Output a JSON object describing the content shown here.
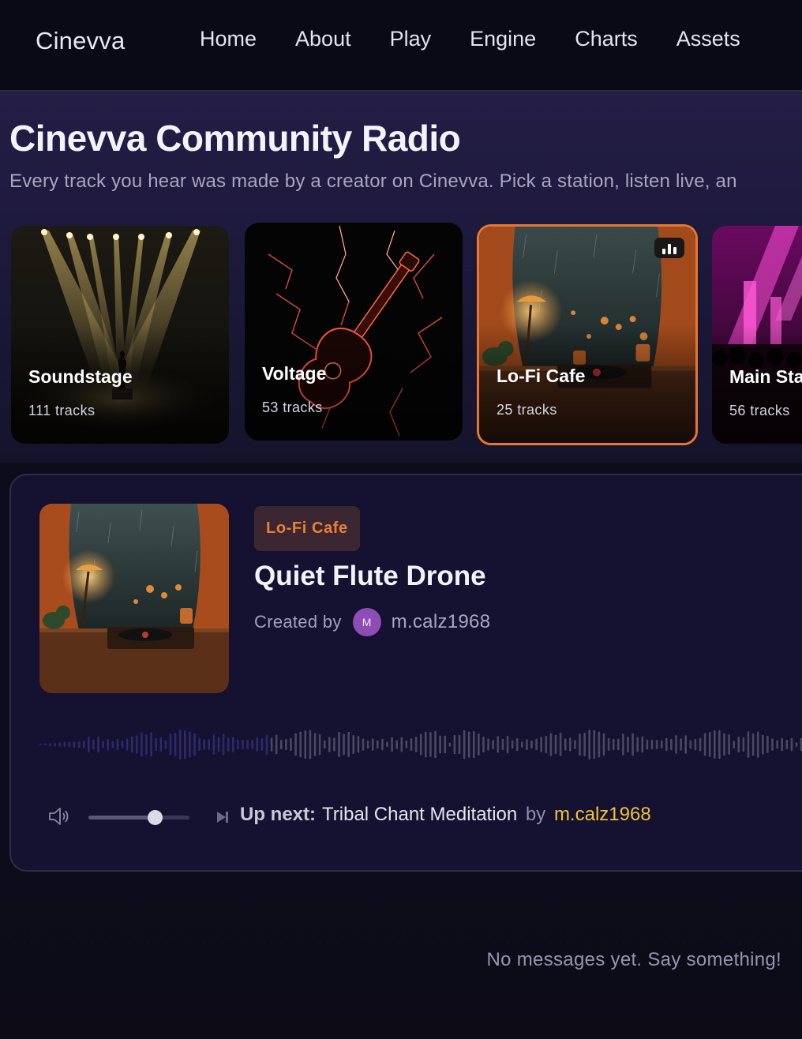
{
  "nav": {
    "brand": "Cinevva",
    "links": [
      "Home",
      "About",
      "Play",
      "Engine",
      "Charts",
      "Assets"
    ]
  },
  "hero": {
    "title": "Cinevva Community Radio",
    "subtitle": "Every track you hear was made by a creator on Cinevva. Pick a station, listen live, an"
  },
  "stations": [
    {
      "name": "Soundstage",
      "count": "111 tracks",
      "art": "spotlight-stage",
      "active": false
    },
    {
      "name": "Voltage",
      "count": "53 tracks",
      "art": "lightning-guitar",
      "active": false
    },
    {
      "name": "Lo-Fi Cafe",
      "count": "25 tracks",
      "art": "rainy-window-turntable",
      "active": true
    },
    {
      "name": "Main Sta",
      "count": "56 tracks",
      "art": "concert-crowd",
      "active": false
    }
  ],
  "player": {
    "station_chip": "Lo-Fi Cafe",
    "track_title": "Quiet Flute Drone",
    "created_by_label": "Created by",
    "avatar_initial": "M",
    "creator": "m.calz1968",
    "volume_level": 0.66,
    "up_next_label": "Up next:",
    "up_next_track": "Tribal Chant Meditation",
    "up_next_by": "by",
    "up_next_creator": "m.calz1968",
    "colors": {
      "accent": "#e8772e",
      "creator_link": "#f0c23a",
      "avatar": "#8e4db5"
    }
  },
  "chat": {
    "empty_message": "No messages yet. Say something!"
  }
}
